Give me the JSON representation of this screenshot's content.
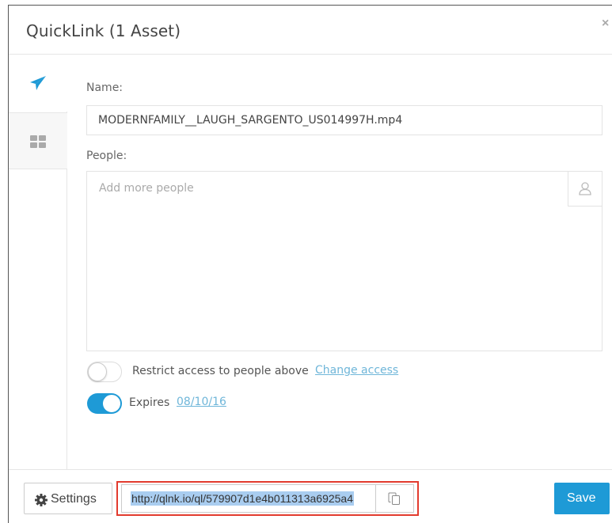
{
  "modal": {
    "title": "QuickLink (1 Asset)",
    "close_glyph": "×"
  },
  "colors": {
    "accent": "#1e9ad6",
    "link": "#6fb6d9",
    "highlight_border": "#e23b2e",
    "selection": "#a9cdf0"
  },
  "sidebar": {
    "items": [
      {
        "icon": "paper-plane-icon",
        "active": true
      },
      {
        "icon": "grid-icon",
        "active": false
      }
    ]
  },
  "form": {
    "name_label": "Name:",
    "name_value": "MODERNFAMILY__LAUGH_SARGENTO_US014997H.mp4",
    "people_label": "People:",
    "people_placeholder": "Add more people",
    "people_icon": "person-icon",
    "restrict": {
      "label": "Restrict access to people above",
      "link": "Change access",
      "enabled": false
    },
    "expires": {
      "label": "Expires",
      "date": "08/10/16",
      "enabled": true
    }
  },
  "footer": {
    "settings_label": "Settings",
    "settings_icon": "gear-icon",
    "url": "http://qlnk.io/ql/579907d1e4b011313a6925a4",
    "copy_icon": "copy-icon",
    "save_label": "Save"
  }
}
